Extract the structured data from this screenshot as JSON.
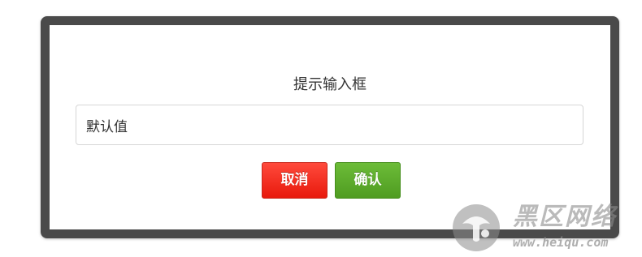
{
  "dialog": {
    "title": "提示输入框",
    "input_value": "默认值",
    "cancel_label": "取消",
    "confirm_label": "确认"
  },
  "colors": {
    "frame": "#4a4a4a",
    "cancel_button": "#f2291b",
    "confirm_button": "#5aaa2a"
  },
  "watermark": {
    "brand": "黑区网络",
    "url": "www.heiqu.com",
    "logo_icon": "mushroom-logo-icon"
  }
}
